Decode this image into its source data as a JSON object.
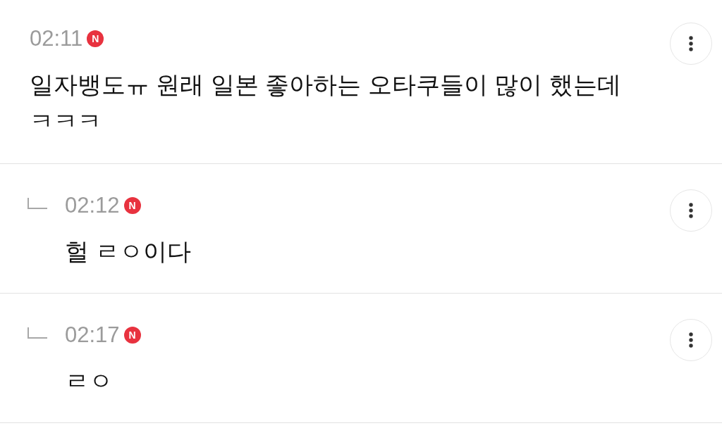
{
  "comments": [
    {
      "time": "02:11",
      "badge": "N",
      "text": "일자뱅도ㅠ 원래 일본 좋아하는 오타쿠들이 많이 했는데 ㅋㅋㅋ",
      "children": [
        {
          "time": "02:12",
          "badge": "N",
          "text": "헐 ㄹㅇ이다"
        },
        {
          "time": "02:17",
          "badge": "N",
          "text": "ㄹㅇ"
        }
      ]
    }
  ]
}
